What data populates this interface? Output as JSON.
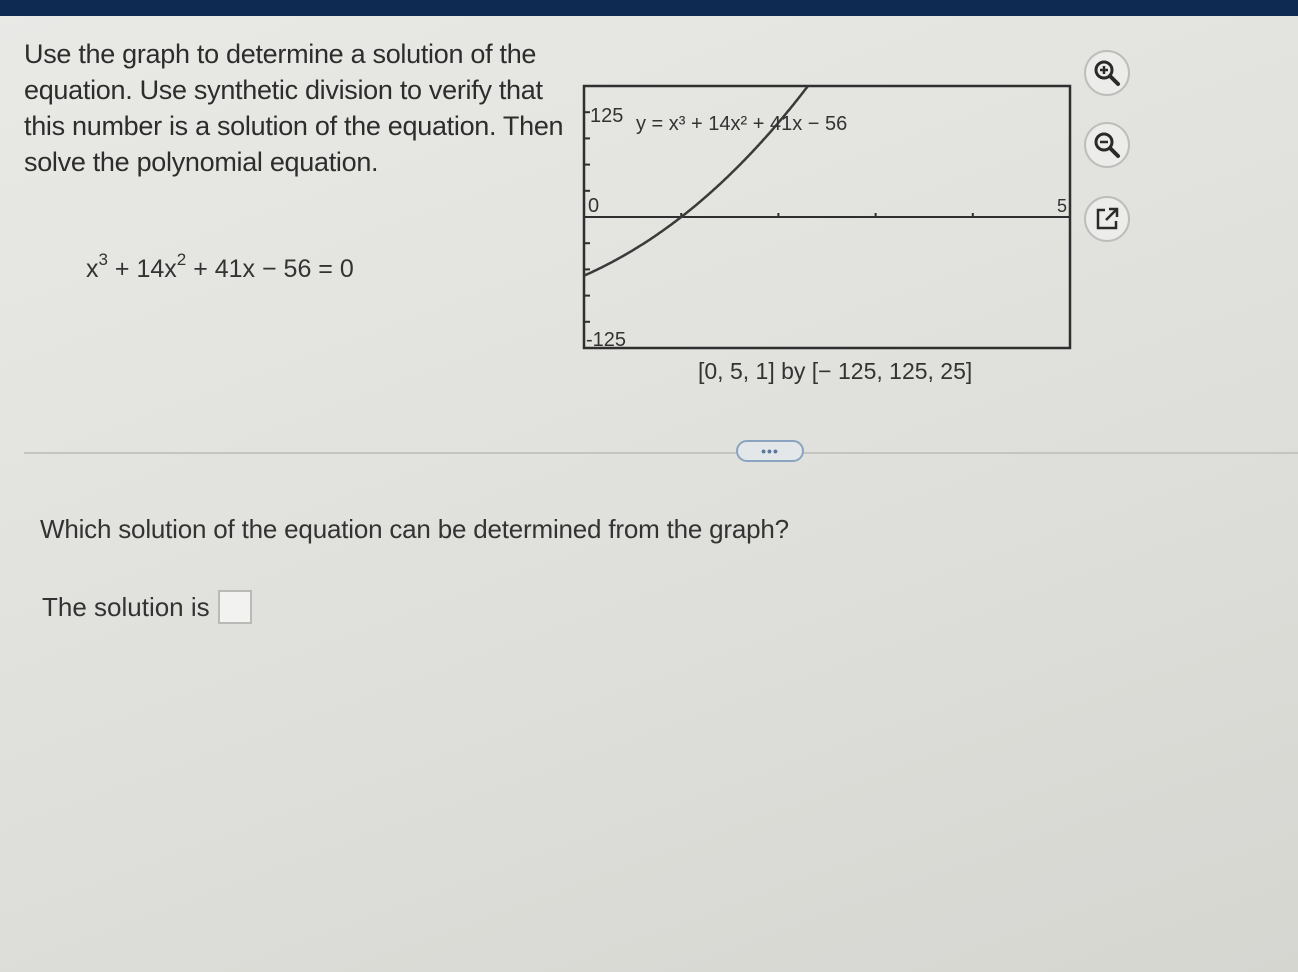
{
  "problem": {
    "instructions": "Use the graph to determine a solution of the equation. Use synthetic division to verify that this number is a solution of the equation. Then solve the polynomial equation.",
    "equation": {
      "term1_base": "x",
      "term1_exp": "3",
      "op1": " + 14x",
      "term2_exp": "2",
      "rest": " + 41x − 56 = 0"
    }
  },
  "graph": {
    "function_label": "y = x³ + 14x² + 41x − 56",
    "y_max_label": "125",
    "y_min_label": "-125",
    "x_min_label": "0",
    "x_max_label": "5",
    "window_label": "[0, 5, 1] by [− 125, 125, 25]"
  },
  "chart_data": {
    "type": "line",
    "title": "y = x³ + 14x² + 41x − 56",
    "function": "x^3 + 14x^2 + 41x - 56",
    "xlim": [
      0,
      5
    ],
    "ylim": [
      -125,
      125
    ],
    "x_scale": 1,
    "y_scale": 25,
    "x": [
      0,
      0.25,
      0.5,
      0.75,
      1,
      1.25,
      1.5,
      1.75,
      2
    ],
    "y": [
      -56,
      -44.9,
      -32.4,
      -18.3,
      0,
      17.1,
      36.4,
      57.7,
      80
    ],
    "series_color": "#3a3a3a"
  },
  "toolbar": {
    "zoom_in": "zoom-in-icon",
    "zoom_out": "zoom-out-icon",
    "open_new_window": "external-link-icon"
  },
  "more_button": "•••",
  "question": {
    "prompt": "Which solution of the equation can be determined from the graph?",
    "answer_label": "The solution is",
    "answer_value": ""
  }
}
